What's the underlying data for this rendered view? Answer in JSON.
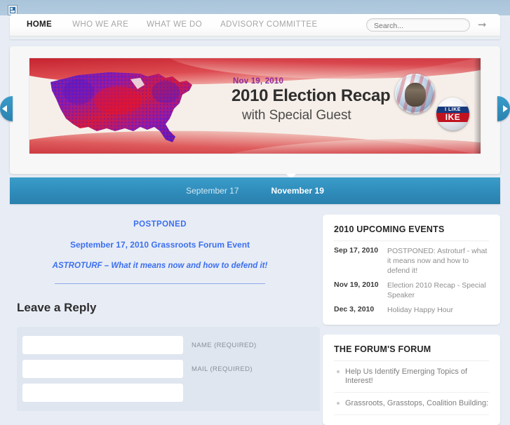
{
  "header": {
    "broken_image_icon": "broken-image-icon",
    "nav_items": [
      {
        "label": "HOME",
        "active": true
      },
      {
        "label": "WHO WE ARE",
        "active": false
      },
      {
        "label": "WHAT WE DO",
        "active": false
      },
      {
        "label": "ADVISORY COMMITTEE",
        "active": false
      }
    ],
    "search": {
      "placeholder": "Search...",
      "value": "",
      "submit_icon": "arrow-right-icon"
    }
  },
  "slider": {
    "prev_icon": "chevron-left-icon",
    "next_icon": "chevron-right-icon",
    "banner": {
      "date": "Nov 19, 2010",
      "title": "2010 Election Recap",
      "subtitle": "with Special Guest",
      "map_alt": "us-election-county-map",
      "badge_portrait_alt": "theodore-roosevelt-campaign-button",
      "badge_ike_line1": "I LIKE",
      "badge_ike_line2": "IKE",
      "colors": {
        "date": "#8d2a9b",
        "title": "#2f2f2f",
        "swoosh_red": "#c3202c",
        "map_red": "#e01b2e",
        "map_blue": "#3417c4"
      }
    },
    "tabs": [
      {
        "label": "September 17",
        "active": false
      },
      {
        "label": "November 19",
        "active": true
      }
    ]
  },
  "main": {
    "post": {
      "line1": "POSTPONED",
      "line2": "September 17, 2010 Grassroots Forum Event",
      "line3": "ASTROTURF – What it means now and how to defend it!",
      "link_color": "#3c6ff0"
    },
    "reply": {
      "heading": "Leave a Reply",
      "fields": [
        {
          "name": "name",
          "value": "",
          "label": "NAME (REQUIRED)"
        },
        {
          "name": "mail",
          "value": "",
          "label": "MAIL (REQUIRED)"
        }
      ]
    }
  },
  "sidebar": {
    "events_card": {
      "title": "2010 UPCOMING EVENTS",
      "events": [
        {
          "date": "Sep 17, 2010",
          "text": "POSTPONED: Astroturf - what it means now and how to defend it!"
        },
        {
          "date": "Nov 19, 2010",
          "text": "Election 2010 Recap - Special Speaker"
        },
        {
          "date": "Dec 3, 2010",
          "text": "Holiday Happy Hour"
        }
      ]
    },
    "forum_card": {
      "title": "THE FORUM'S FORUM",
      "items": [
        {
          "text": "Help Us Identify Emerging Topics of Interest!"
        },
        {
          "text": "Grassroots, Grasstops, Coalition Building:"
        }
      ]
    }
  }
}
